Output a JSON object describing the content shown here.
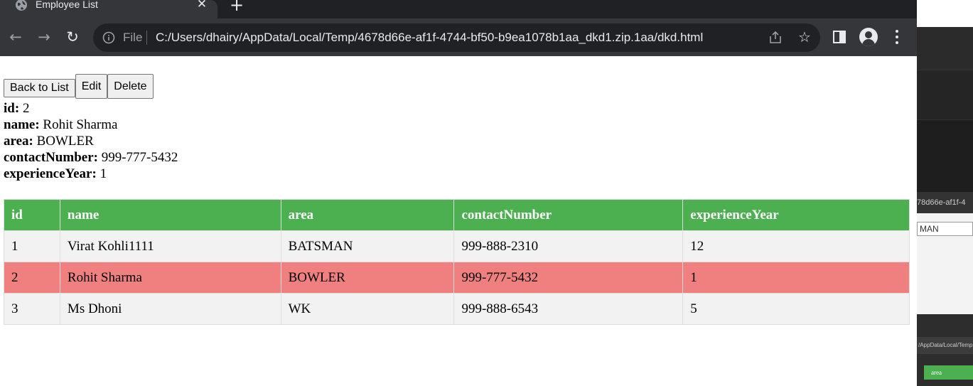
{
  "browser": {
    "tab_title": "Employee List",
    "file_label": "File",
    "url": "C:/Users/dhairy/AppData/Local/Temp/4678d66e-af1f-4744-bf50-b9ea1078b1aa_dkd1.zip.1aa/dkd.html"
  },
  "background_window": {
    "path_fragment": "78d66e-af1f-4",
    "input_value": "MAN",
    "bottom_path": "/AppData/Local/Temp",
    "bottom_header": "area"
  },
  "buttons": {
    "back": "Back to List",
    "edit": "Edit",
    "delete": "Delete"
  },
  "detail": {
    "fields": [
      {
        "label": "id:",
        "value": "2"
      },
      {
        "label": "name:",
        "value": "Rohit Sharma"
      },
      {
        "label": "area:",
        "value": "BOWLER"
      },
      {
        "label": "contactNumber:",
        "value": "999-777-5432"
      },
      {
        "label": "experienceYear:",
        "value": "1"
      }
    ]
  },
  "table": {
    "headers": [
      "id",
      "name",
      "area",
      "contactNumber",
      "experienceYear"
    ],
    "rows": [
      [
        "1",
        "Virat Kohli1111",
        "BATSMAN",
        "999-888-2310",
        "12"
      ],
      [
        "2",
        "Rohit Sharma",
        "BOWLER",
        "999-777-5432",
        "1"
      ],
      [
        "3",
        "Ms Dhoni",
        "WK",
        "999-888-6543",
        "5"
      ]
    ],
    "selected_row": 1,
    "header_color": "#4caf50",
    "selected_color": "#f08080"
  }
}
